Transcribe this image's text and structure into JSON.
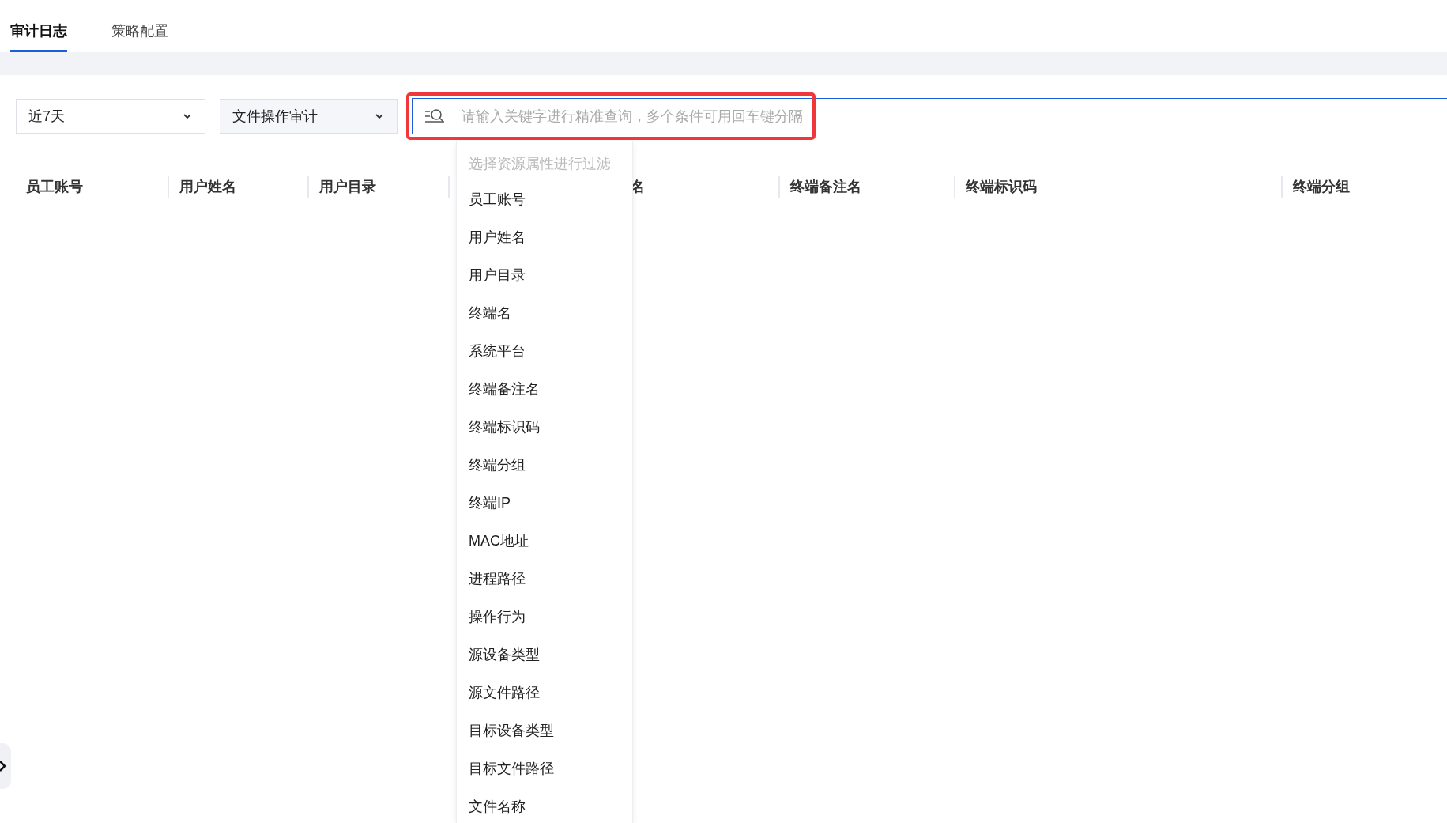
{
  "tabs": [
    {
      "label": "审计日志",
      "selected": true
    },
    {
      "label": "策略配置",
      "selected": false
    }
  ],
  "time_range": {
    "value": "近7天"
  },
  "audit_type": {
    "value": "文件操作审计"
  },
  "search": {
    "placeholder": "请输入关键字进行精准查询，多个条件可用回车键分隔",
    "highlighted": true
  },
  "filter_menu": {
    "hint": "选择资源属性进行过滤",
    "items": [
      "员工账号",
      "用户姓名",
      "用户目录",
      "终端名",
      "系统平台",
      "终端备注名",
      "终端标识码",
      "终端分组",
      "终端IP",
      "MAC地址",
      "进程路径",
      "操作行为",
      "源设备类型",
      "源文件路径",
      "目标设备类型",
      "目标文件路径",
      "文件名称"
    ]
  },
  "table": {
    "columns": [
      "员工账号",
      "用户姓名",
      "用户目录",
      "名",
      "终端备注名",
      "终端标识码",
      "终端分组"
    ]
  }
}
